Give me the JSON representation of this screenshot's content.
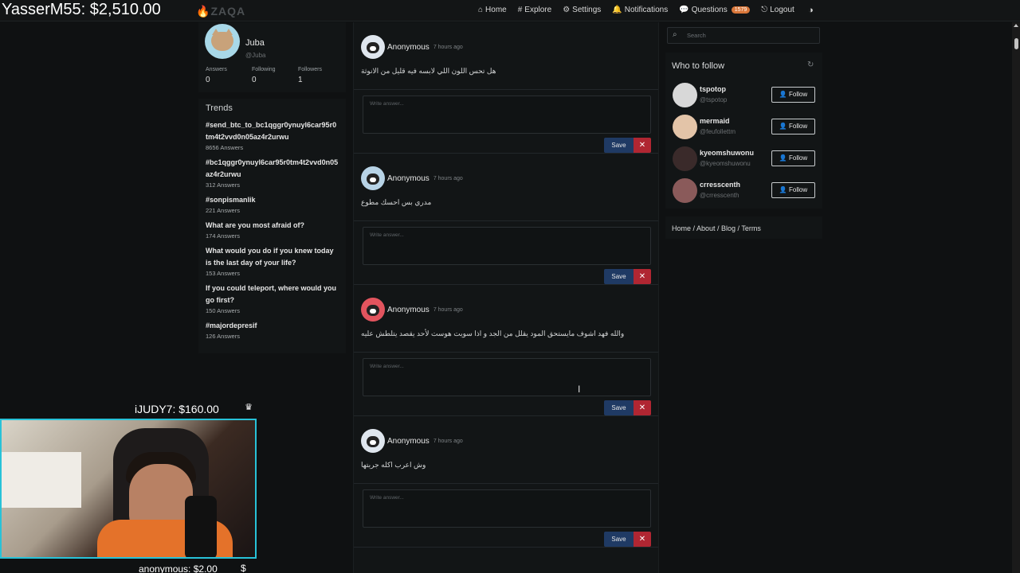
{
  "overlay": {
    "top_donation": "YasserM55: $2,510.00",
    "mid_donation": "iJUDY7: $160.00",
    "bottom_donation": "anonymous: $2.00",
    "mid_icon": "crown-icon",
    "bottom_icon": "dollar-icon"
  },
  "navbar": {
    "logo": "ZAQA",
    "items": [
      {
        "icon": "⌂",
        "label": "Home"
      },
      {
        "icon": "#",
        "label": "Explore"
      },
      {
        "icon": "⚙",
        "label": "Settings"
      },
      {
        "icon": "🔔",
        "label": "Notifications"
      },
      {
        "icon": "💬",
        "label": "Questions",
        "badge": "1579"
      },
      {
        "icon": "⎋",
        "label": "Logout"
      }
    ],
    "theme_icon": "◑"
  },
  "profile": {
    "name": "Juba",
    "handle": "@Juba",
    "stats": [
      {
        "label": "Answers",
        "value": "0"
      },
      {
        "label": "Following",
        "value": "0"
      },
      {
        "label": "Followers",
        "value": "1"
      }
    ]
  },
  "trends": {
    "title": "Trends",
    "items": [
      {
        "name": "#send_btc_to_bc1qggr0ynuyl6car95r0tm4t2vvd0n05az4r2urwu",
        "count": "8656 Answers"
      },
      {
        "name": "#bc1qggr0ynuyl6car95r0tm4t2vvd0n05az4r2urwu",
        "count": "312 Answers"
      },
      {
        "name": "#sonpismanlik",
        "count": "221 Answers"
      },
      {
        "name": "What are you most afraid of?",
        "count": "174 Answers"
      },
      {
        "name": "What would you do if you knew today is the last day of your life?",
        "count": "153 Answers"
      },
      {
        "name": "If you could teleport, where would you go first?",
        "count": "150 Answers"
      },
      {
        "name": "#majordepresif",
        "count": "126 Answers"
      }
    ]
  },
  "feed": {
    "questions": [
      {
        "user": "Anonymous",
        "time": "7 hours ago",
        "text": "هل تحس اللون اللي لابسه فيه قليل من الانوثة",
        "placeholder": "Write answer...",
        "save": "Save",
        "cancel": "✕"
      },
      {
        "user": "Anonymous",
        "time": "7 hours ago",
        "text": "مدري بس احسك مطوع",
        "placeholder": "Write answer...",
        "save": "Save",
        "cancel": "✕"
      },
      {
        "user": "Anonymous",
        "time": "7 hours ago",
        "text": "والله فهد اشوف مايستحق المود يقلل من الجد و اذا سويت هوست لأحد يقصد يتلطش عليه",
        "placeholder": "Write answer...",
        "save": "Save",
        "cancel": "✕"
      },
      {
        "user": "Anonymous",
        "time": "7 hours ago",
        "text": "وش اعرب اكله جربتها",
        "placeholder": "Write answer...",
        "save": "Save",
        "cancel": "✕"
      }
    ]
  },
  "sidebar": {
    "search_placeholder": "Search",
    "who_to_follow": {
      "title": "Who to follow",
      "users": [
        {
          "name": "tspotop",
          "handle": "@tspotop",
          "button": "Follow",
          "color": "#d8d8d8"
        },
        {
          "name": "mermaid",
          "handle": "@feufollettm",
          "button": "Follow",
          "color": "#e3c4a8"
        },
        {
          "name": "kyeomshuwonu",
          "handle": "@kyeomshuwonu",
          "button": "Follow",
          "color": "#3a2a2a"
        },
        {
          "name": "crresscenth",
          "handle": "@crresscenth",
          "button": "Follow",
          "color": "#8a5a5a"
        }
      ]
    },
    "footer_links": "Home / About / Blog / Terms"
  }
}
